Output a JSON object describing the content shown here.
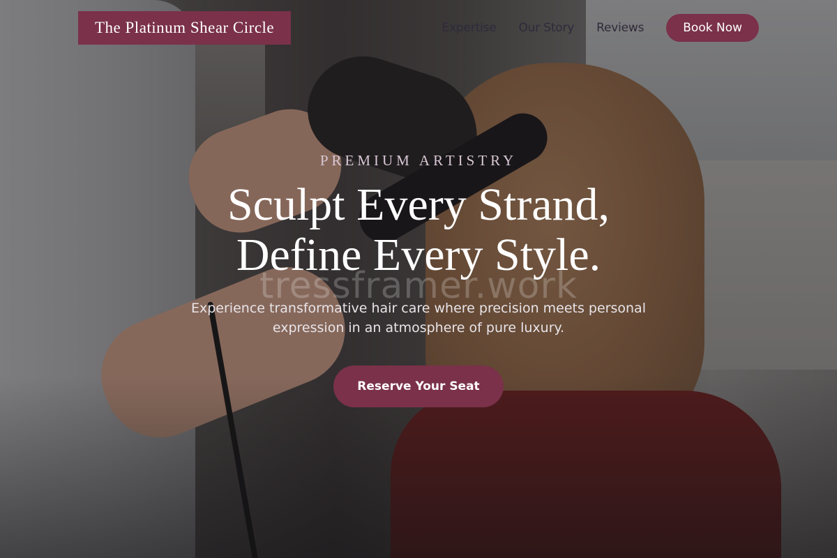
{
  "header": {
    "logo": "The Platinum Shear Circle",
    "nav": [
      "Expertise",
      "Our Story",
      "Reviews"
    ],
    "book_button": "Book Now"
  },
  "hero": {
    "eyebrow": "PREMIUM ARTISTRY",
    "headline_line1": "Sculpt Every Strand,",
    "headline_line2": "Define Every Style.",
    "watermark": "tressframer.work",
    "subtitle": "Experience transformative hair care where precision meets personal expression in an atmosphere of pure luxury.",
    "cta": "Reserve Your Seat"
  },
  "colors": {
    "accent": "#7a3149",
    "text_light": "#ffffff",
    "nav_text": "#2f2a3a"
  }
}
